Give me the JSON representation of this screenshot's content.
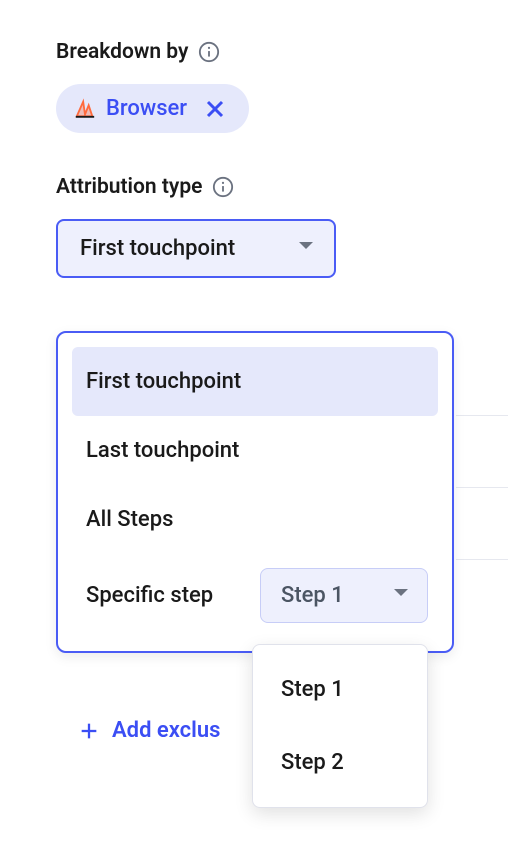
{
  "breakdown": {
    "label": "Breakdown by",
    "chip": {
      "text": "Browser"
    }
  },
  "attribution": {
    "label": "Attribution type",
    "selected": "First touchpoint",
    "options": {
      "first": "First touchpoint",
      "last": "Last touchpoint",
      "all": "All Steps",
      "specific": "Specific step"
    },
    "specific_step": {
      "selected": "Step 1",
      "options": {
        "s1": "Step 1",
        "s2": "Step 2"
      }
    }
  },
  "add_exclusion": {
    "label": "Add exclus"
  }
}
